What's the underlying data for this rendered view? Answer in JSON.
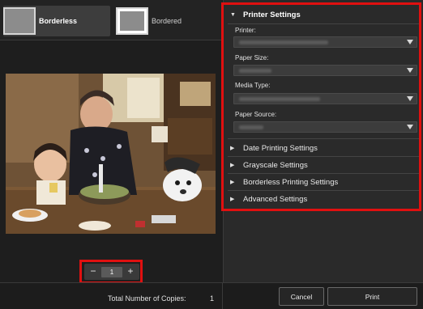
{
  "layouts": {
    "borderless_label": "Borderless",
    "bordered_label": "Bordered",
    "selected": "Borderless"
  },
  "preview": {
    "copies_value": "1",
    "minus_icon": "minus-icon",
    "plus_icon": "plus-icon"
  },
  "settings": {
    "printer_settings": {
      "title": "Printer Settings",
      "expanded": true,
      "fields": [
        {
          "label": "Printer:"
        },
        {
          "label": "Paper Size:"
        },
        {
          "label": "Media Type:"
        },
        {
          "label": "Paper Source:"
        }
      ]
    },
    "collapsed_sections": [
      "Date Printing Settings",
      "Grayscale Settings",
      "Borderless Printing Settings",
      "Advanced Settings"
    ]
  },
  "footer": {
    "total_copies_label": "Total Number of Copies:",
    "total_copies_value": "1",
    "cancel_label": "Cancel",
    "print_label": "Print"
  },
  "colors": {
    "highlight": "#e01010",
    "panel_bg": "#2a2a2a",
    "window_bg": "#1e1e1e"
  }
}
